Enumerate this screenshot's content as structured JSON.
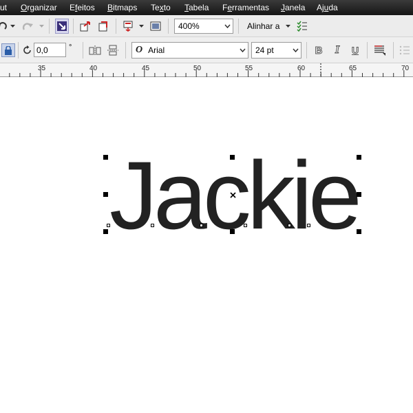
{
  "menubar": {
    "items": [
      {
        "pre": "",
        "mnemonic": "",
        "post": "ut"
      },
      {
        "pre": "",
        "mnemonic": "O",
        "post": "rganizar"
      },
      {
        "pre": "E",
        "mnemonic": "f",
        "post": "eitos"
      },
      {
        "pre": "",
        "mnemonic": "B",
        "post": "itmaps"
      },
      {
        "pre": "Te",
        "mnemonic": "x",
        "post": "to"
      },
      {
        "pre": "",
        "mnemonic": "T",
        "post": "abela"
      },
      {
        "pre": "F",
        "mnemonic": "e",
        "post": "rramentas"
      },
      {
        "pre": "",
        "mnemonic": "J",
        "post": "anela"
      },
      {
        "pre": "Aj",
        "mnemonic": "u",
        "post": "da"
      }
    ]
  },
  "toolbar1": {
    "zoom_value": "400%",
    "align_label": "Alinhar a"
  },
  "toolbar2": {
    "rotation_value": "0,0",
    "degree_symbol": "°",
    "font_name": "Arial",
    "font_size": "24 pt",
    "bold_glyph": "B",
    "italic_glyph": "I",
    "underline_glyph": "U"
  },
  "ruler": {
    "labels": [
      "35",
      "40",
      "45",
      "50",
      "55",
      "60",
      "65",
      "70"
    ]
  },
  "canvas": {
    "text": "Jackie",
    "text_color": "#222222"
  },
  "colors": {
    "menubar_bg": "#1f1f1f",
    "toolbar_bg": "#ececec",
    "accent_blue": "#2a5da8"
  }
}
